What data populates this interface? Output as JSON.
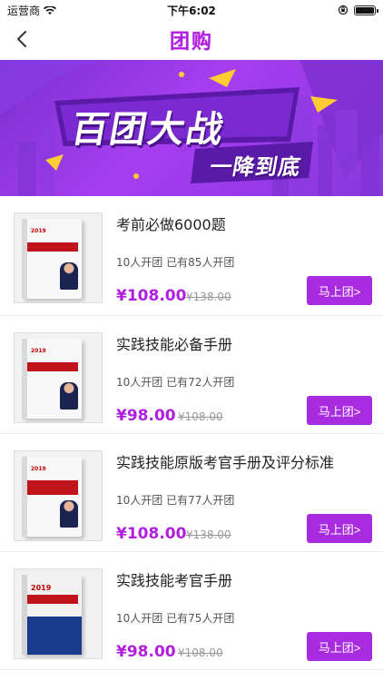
{
  "status": {
    "carrier": "运营商",
    "time": "下午6:02"
  },
  "nav": {
    "title": "团购"
  },
  "banner": {
    "title": "百团大战",
    "subtitle": "一降到底"
  },
  "products": [
    {
      "title": "考前必做6000题",
      "meta": "10人开团 已有85人开团",
      "price": "¥108.00",
      "original": "¥138.00",
      "button": "马上团>",
      "cover": "#f4f4f4",
      "cover_year": "2019"
    },
    {
      "title": "实践技能必备手册",
      "meta": "10人开团 已有72人开团",
      "price": "¥98.00",
      "original": "¥108.00",
      "button": "马上团>",
      "cover": "#f4f4f4",
      "cover_year": "2019"
    },
    {
      "title": "实践技能原版考官手册及评分标准",
      "meta": "10人开团 已有77人开团",
      "price": "¥108.00",
      "original": "¥138.00",
      "button": "马上团>",
      "cover": "#f4f4f4",
      "cover_year": "2019"
    },
    {
      "title": "实践技能考官手册",
      "meta": "10人开团 已有75人开团",
      "price": "¥98.00",
      "original": "¥108.00",
      "button": "马上团>",
      "cover": "#1a3a8c",
      "cover_year": "2019"
    }
  ]
}
